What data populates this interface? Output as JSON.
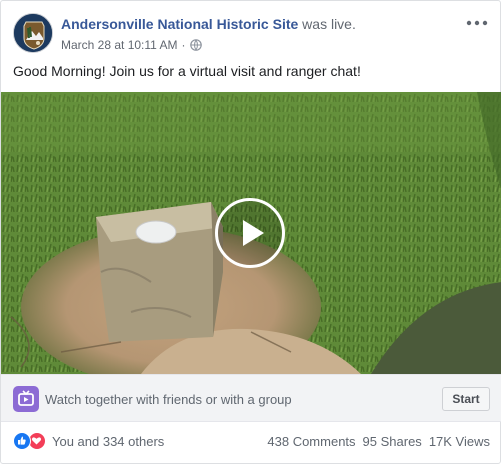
{
  "post": {
    "page_name": "Andersonville National Historic Site",
    "status": "was live.",
    "date": "March 28 at 10:11 AM",
    "separator": "·",
    "more_icon": "more-dots-icon",
    "globe_icon": "globe-icon",
    "caption": "Good Morning! Join us for a virtual visit and ranger chat!"
  },
  "video": {
    "play_icon": "play-icon"
  },
  "watch_party": {
    "icon": "watch-party-icon",
    "text": "Watch together with friends or with a group",
    "button": "Start"
  },
  "engagement": {
    "reactions": [
      "like",
      "love"
    ],
    "reaction_text": "You and 334 others",
    "comments": "438 Comments",
    "shares": "95 Shares",
    "views": "17K Views"
  },
  "colors": {
    "link": "#385898",
    "like": "#1877f2",
    "love": "#f33e58",
    "watch": "#8c6bd4"
  }
}
